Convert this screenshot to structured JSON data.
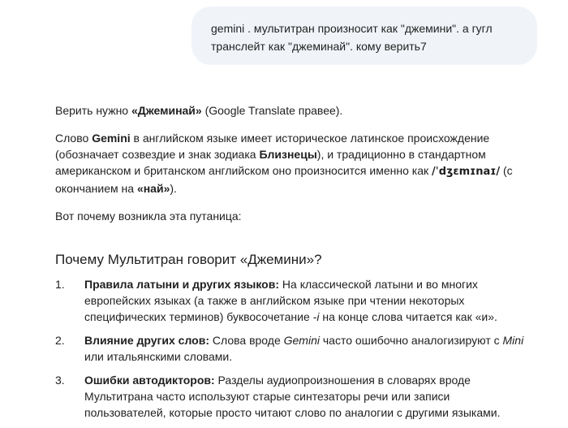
{
  "user_message": {
    "line1": "gemini . мультитран произносит как \"джемини\". а гугл",
    "line2": "транслейт как \"джеминай\". кому верить7"
  },
  "response": {
    "p1": {
      "a": "Верить нужно ",
      "b": "«Джеминай»",
      "c": " (Google Translate правее)."
    },
    "p2": {
      "a": "Слово ",
      "b": "Gemini",
      "c": " в английском языке имеет историческое латинское происхождение (обозначает созвездие и знак зодиака ",
      "d": "Близнецы",
      "e": "), и традиционно в стандартном американском и британском английском оно произносится именно как ",
      "f": "/ˈdʒɛmɪnaɪ/",
      "g": " (с окончанием на ",
      "h": "«най»",
      "i": ")."
    },
    "p3": "Вот почему возникла эта путаница:",
    "heading": "Почему Мультитран говорит «Джемини»?",
    "items": [
      {
        "num": "1.",
        "bold": "Правила латыни и других языков:",
        "text1": " На классической латыни и во многих европейских языках (а также в английском языке при чтении некоторых специфических терминов) буквосочетание ",
        "ital": "-i",
        "text2": " на конце слова читается как «и»."
      },
      {
        "num": "2.",
        "bold": "Влияние других слов:",
        "text1": " Слова вроде ",
        "ital1": "Gemini",
        "text2": " часто ошибочно аналогизируют с ",
        "ital2": "Mini",
        "text3": " или итальянскими словами."
      },
      {
        "num": "3.",
        "bold": "Ошибки автодикторов:",
        "text1": " Разделы аудиопроизношения в словарях вроде Мультитрана часто используют старые синтезаторы речи или записи пользователей, которые просто читают слово по аналогии с другими языками."
      }
    ]
  }
}
